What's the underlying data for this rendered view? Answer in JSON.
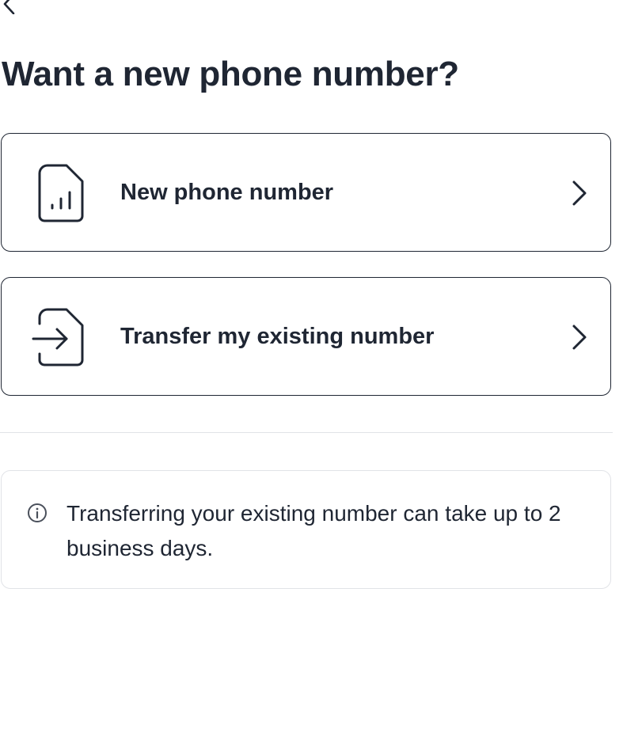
{
  "header": {
    "back_icon": "chevron-left-icon",
    "title": "Want a new phone number?"
  },
  "options": [
    {
      "icon": "sim-card-icon",
      "label": "New phone number",
      "chevron_icon": "chevron-right-icon"
    },
    {
      "icon": "transfer-in-icon",
      "label": "Transfer my existing number",
      "chevron_icon": "chevron-right-icon"
    }
  ],
  "info": {
    "icon": "info-icon",
    "text": "Transferring your existing number can take up to 2 business days."
  },
  "colors": {
    "text": "#1f2633",
    "border": "#1f2633",
    "muted_border": "#e1e3e7",
    "background": "#ffffff"
  }
}
